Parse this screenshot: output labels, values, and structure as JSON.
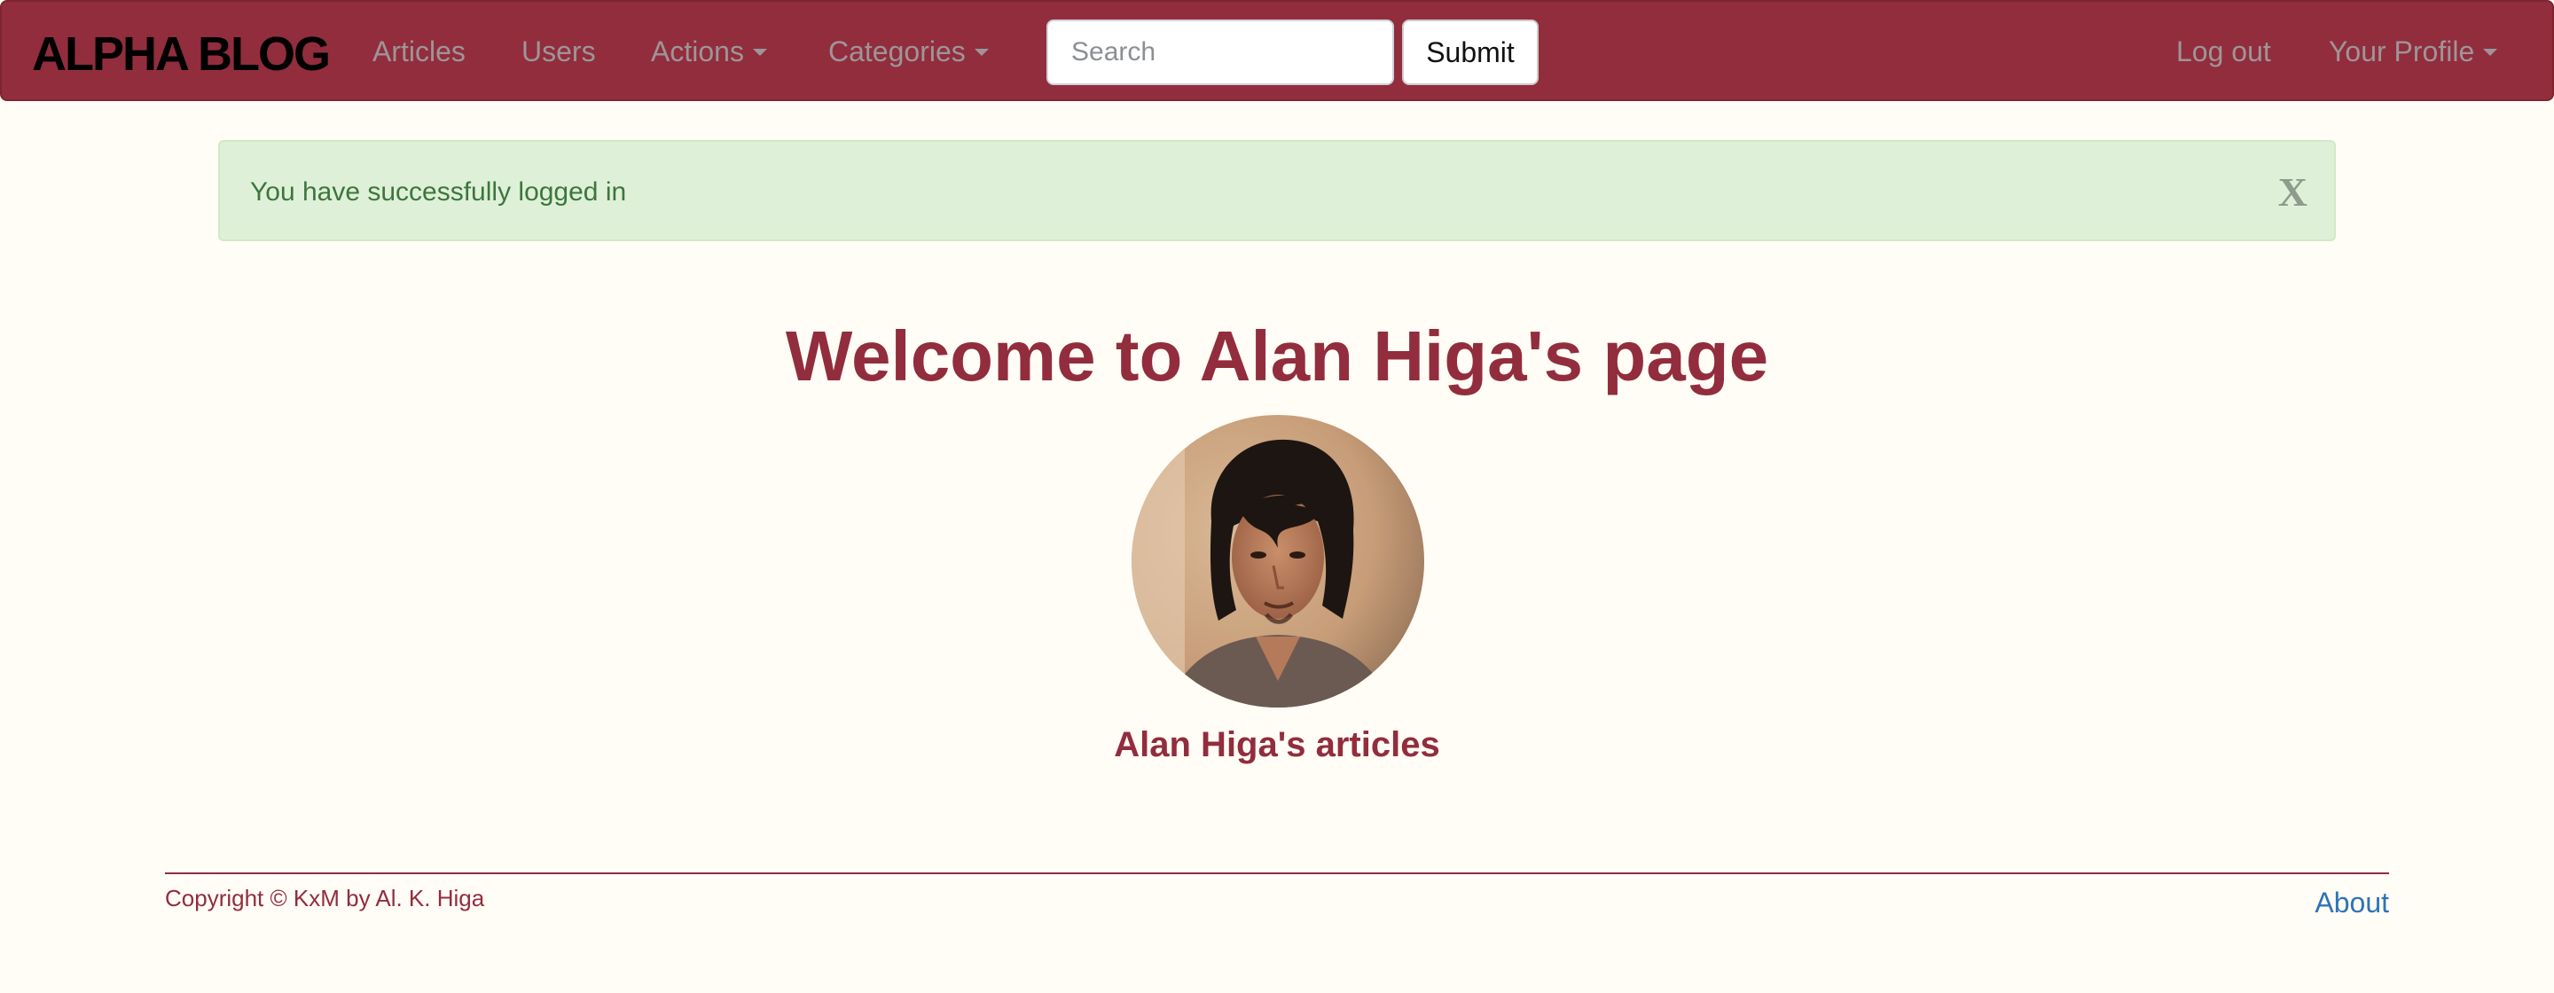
{
  "colors": {
    "navbar_bg": "#922d3d",
    "page_bg": "#fffdf5",
    "accent": "#922d3d",
    "alert_bg": "#dff0d8",
    "alert_text": "#3c763d",
    "link": "#2e73b8"
  },
  "navbar": {
    "brand": "ALPHA BLOG",
    "links": {
      "articles": "Articles",
      "users": "Users",
      "actions": "Actions",
      "categories": "Categories",
      "logout": "Log out",
      "profile": "Your Profile"
    },
    "search": {
      "placeholder": "Search",
      "value": ""
    },
    "submit_label": "Submit"
  },
  "alert": {
    "message": "You have successfully logged in",
    "close_label": "X"
  },
  "main": {
    "title": "Welcome to Alan Higa's page",
    "avatar_icon": "user-photo",
    "articles_heading": "Alan Higa's articles"
  },
  "footer": {
    "copyright": "Copyright © KxM by Al. K. Higa",
    "about": "About"
  }
}
